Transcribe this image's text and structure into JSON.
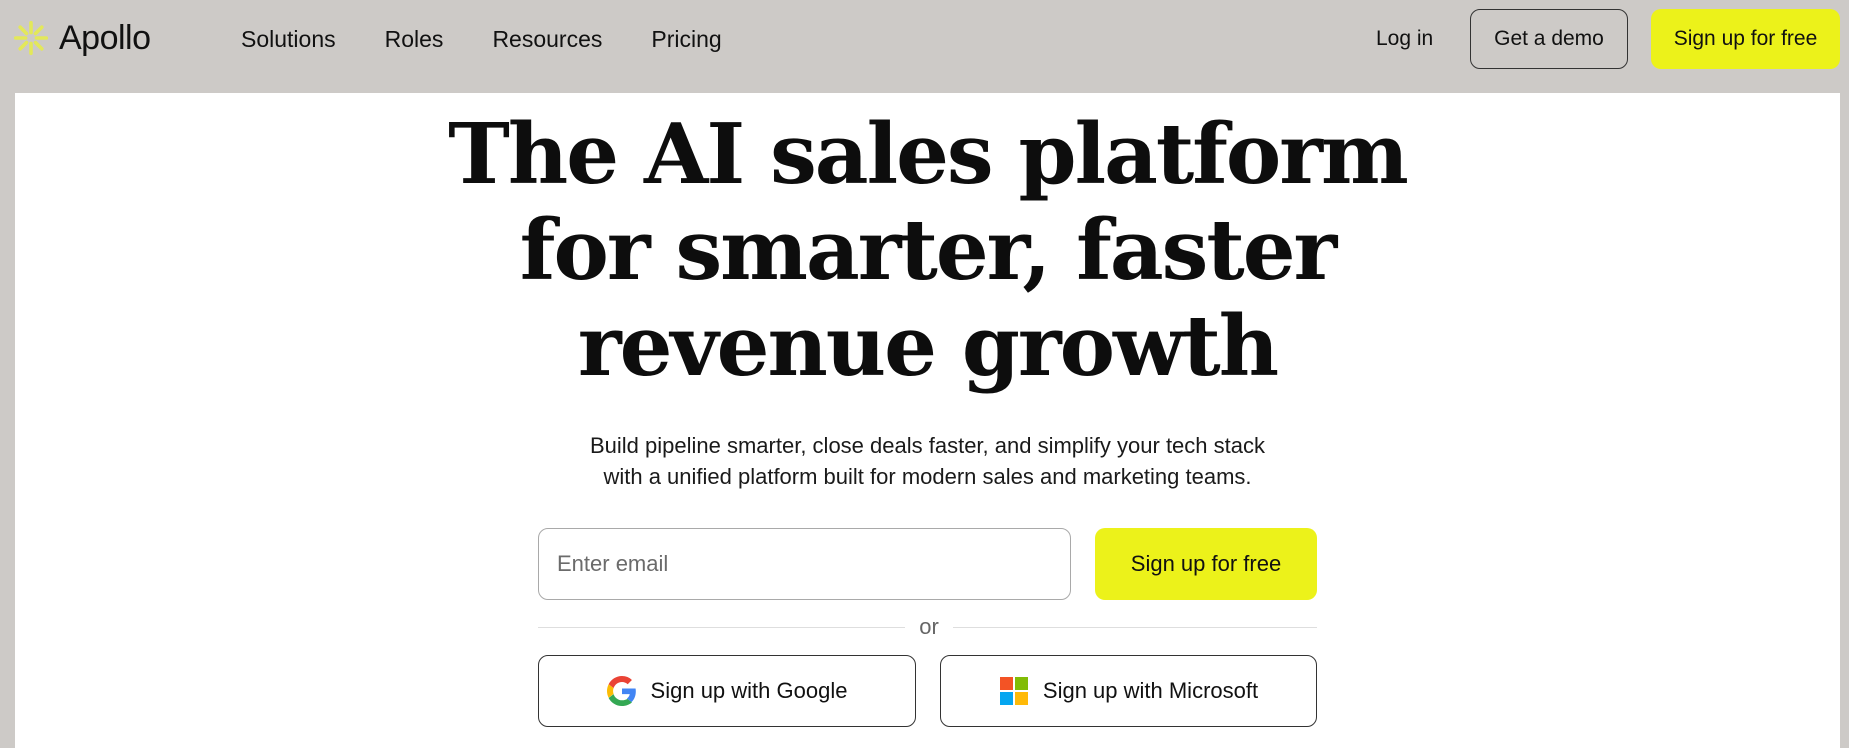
{
  "brand": {
    "name": "Apollo",
    "accent": "#ecf21a",
    "logo_icon": "asterisk-burst-icon"
  },
  "nav": {
    "items": [
      "Solutions",
      "Roles",
      "Resources",
      "Pricing"
    ],
    "login_label": "Log in",
    "demo_label": "Get a demo",
    "signup_label": "Sign up for free"
  },
  "hero": {
    "headline_lines": [
      "The AI sales platform",
      "for smarter, faster",
      "revenue growth"
    ],
    "subtitle_lines": [
      "Build pipeline smarter, close deals faster, and simplify your tech stack",
      "with a unified platform built for modern sales and marketing teams."
    ]
  },
  "signup_form": {
    "email_placeholder": "Enter email",
    "submit_label": "Sign up for free",
    "divider_text": "or",
    "google_label": "Sign up with Google",
    "microsoft_label": "Sign up with Microsoft",
    "google_icon": "google-g-icon",
    "microsoft_icon": "microsoft-squares-icon"
  },
  "colors": {
    "page_background": "#cdcac7",
    "panel_background": "#ffffff",
    "accent_button": "#ecf21a"
  }
}
